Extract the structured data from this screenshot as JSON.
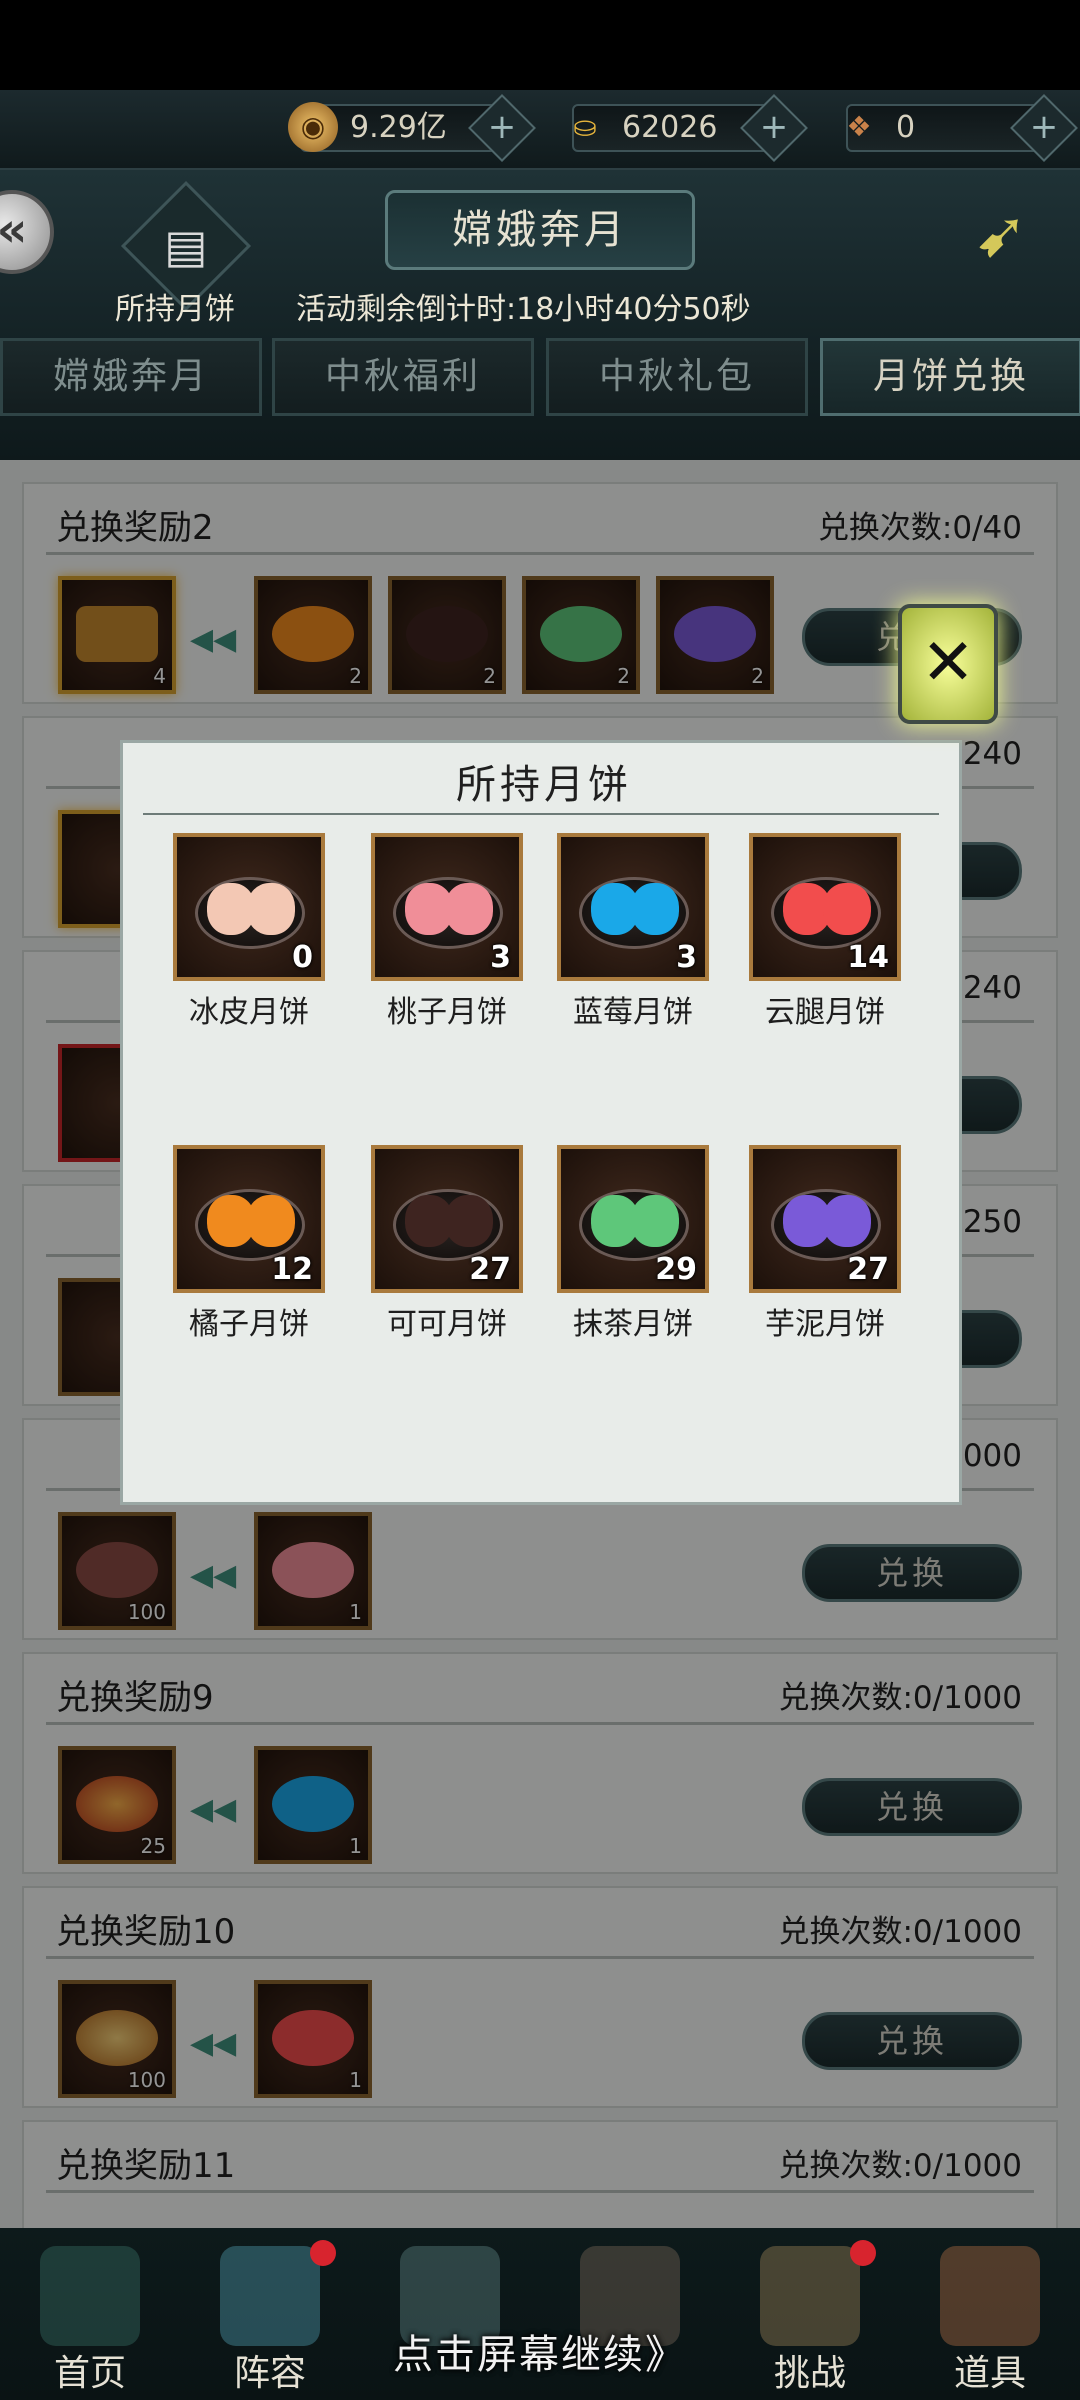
{
  "currency": [
    {
      "icon": "copper-coin-icon",
      "value": "9.29亿"
    },
    {
      "icon": "gold-ingot-icon",
      "value": "62026"
    },
    {
      "icon": "item-bag-icon",
      "value": "0"
    }
  ],
  "header": {
    "title": "嫦娥奔月",
    "held_label": "所持月饼",
    "countdown": "活动剩余倒计时:18小时40分50秒",
    "tabs": [
      "嫦娥奔月",
      "中秋福利",
      "中秋礼包",
      "月饼兑换"
    ],
    "active_tab": 3
  },
  "list": {
    "exchange_label": "兑换",
    "cards": [
      {
        "title": "兑换奖励2",
        "count": "兑换次数:0/40",
        "reward_qty": "4",
        "cost_qty": [
          "2",
          "2",
          "2",
          "2"
        ]
      },
      {
        "count": "240"
      },
      {
        "count": "240"
      },
      {
        "count": "250"
      },
      {
        "count": "1000",
        "reward_qty": "100",
        "cost_qty": [
          "1"
        ]
      },
      {
        "title": "兑换奖励9",
        "count": "兑换次数:0/1000",
        "reward_qty": "25",
        "cost_qty": [
          "1"
        ]
      },
      {
        "title": "兑换奖励10",
        "count": "兑换次数:0/1000",
        "reward_qty": "100",
        "cost_qty": [
          "1"
        ]
      },
      {
        "title": "兑换奖励11",
        "count": "兑换次数:0/1000"
      }
    ]
  },
  "popup": {
    "title": "所持月饼",
    "items": [
      {
        "name": "冰皮月饼",
        "count": "0",
        "color": "#f3c8b4"
      },
      {
        "name": "桃子月饼",
        "count": "3",
        "color": "#f08e98"
      },
      {
        "name": "蓝莓月饼",
        "count": "3",
        "color": "#1aa8e8"
      },
      {
        "name": "云腿月饼",
        "count": "14",
        "color": "#f24d4d"
      },
      {
        "name": "橘子月饼",
        "count": "12",
        "color": "#f08a1e"
      },
      {
        "name": "可可月饼",
        "count": "27",
        "color": "#3e2420"
      },
      {
        "name": "抹茶月饼",
        "count": "29",
        "color": "#5ec77a"
      },
      {
        "name": "芋泥月饼",
        "count": "27",
        "color": "#7a5ad8"
      }
    ]
  },
  "nav": [
    {
      "label": "首页",
      "dot": false
    },
    {
      "label": "阵容",
      "dot": true
    },
    {
      "label": "",
      "dot": false
    },
    {
      "label": "",
      "dot": false
    },
    {
      "label": "挑战",
      "dot": true
    },
    {
      "label": "道具",
      "dot": false
    }
  ],
  "continue_hint": "点击屏幕继续》"
}
